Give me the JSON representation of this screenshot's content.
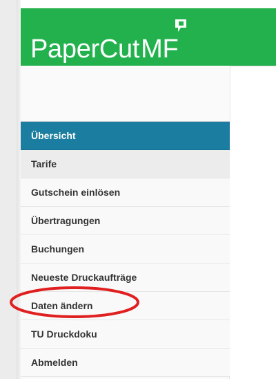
{
  "brand": {
    "name": "PaperCut",
    "suffix": "MF",
    "header_color": "#22b14c",
    "logo_mark_icon": "paper-flag-icon"
  },
  "sidebar": {
    "items": [
      {
        "label": "Übersicht",
        "state": "active"
      },
      {
        "label": "Tarife",
        "state": "hover"
      },
      {
        "label": "Gutschein einlösen",
        "state": "normal"
      },
      {
        "label": "Übertragungen",
        "state": "normal"
      },
      {
        "label": "Buchungen",
        "state": "normal"
      },
      {
        "label": "Neueste Druckaufträge",
        "state": "normal"
      },
      {
        "label": "Daten ändern",
        "state": "highlighted"
      },
      {
        "label": "TU Druckdoku",
        "state": "normal"
      },
      {
        "label": "Abmelden",
        "state": "normal"
      }
    ],
    "active_color": "#1b7ea1",
    "highlight_ring_color": "#e02020"
  }
}
